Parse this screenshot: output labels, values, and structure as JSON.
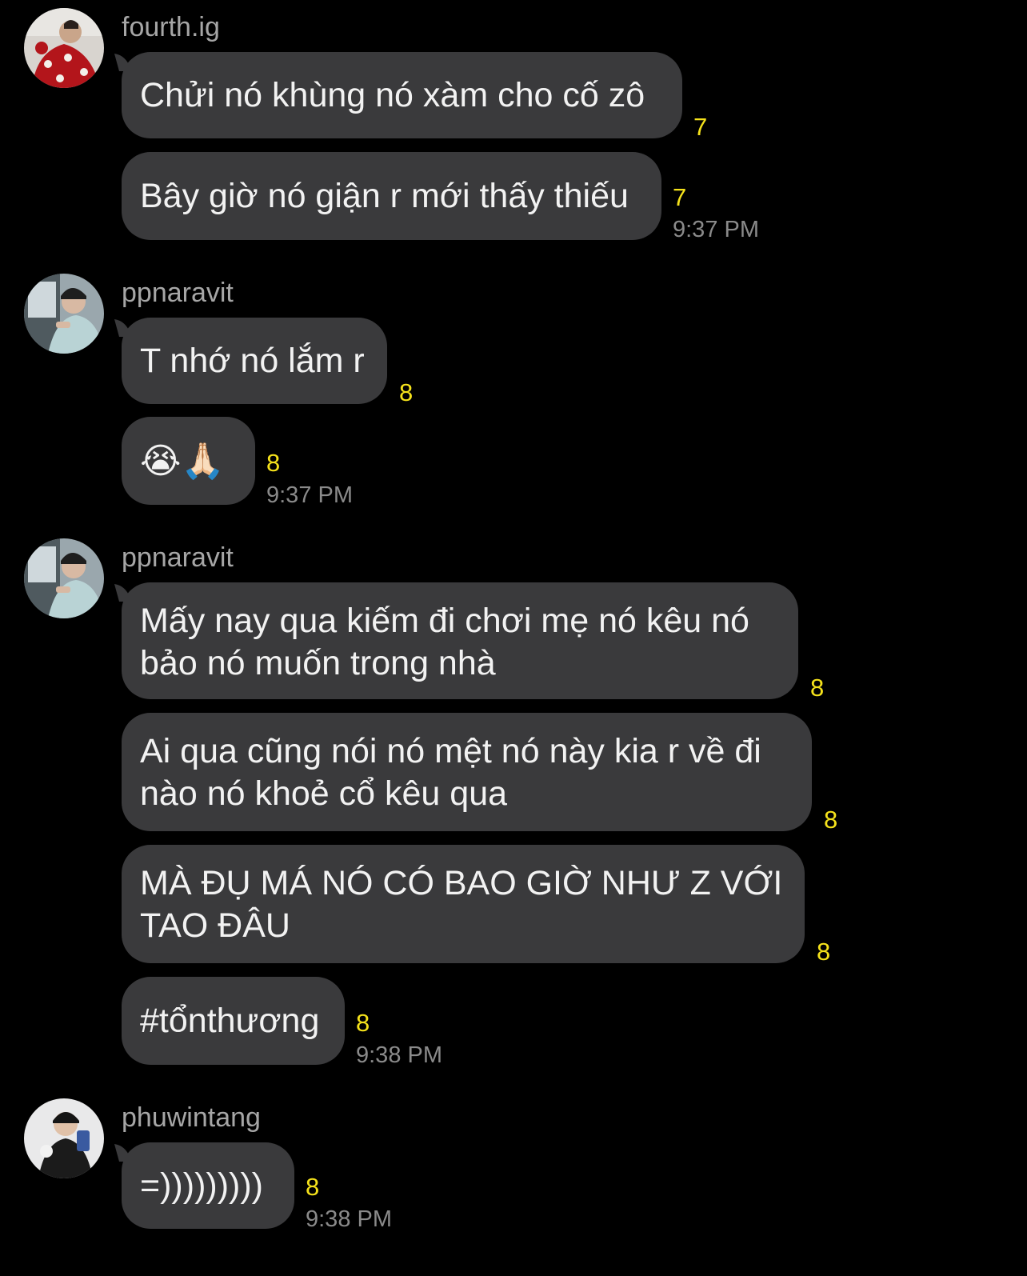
{
  "messages": [
    {
      "username": "fourth.ig",
      "bubbles": [
        {
          "text": "Chửi nó khùng nó xàm cho cố zô",
          "count": "7"
        },
        {
          "text": "Bây giờ nó giận r mới thấy thiếu",
          "count": "7"
        }
      ],
      "time": "9:37 PM"
    },
    {
      "username": "ppnaravit",
      "bubbles": [
        {
          "text": "T nhớ nó lắm r",
          "count": "8"
        },
        {
          "text": "😭🙏🏻",
          "count": "8"
        }
      ],
      "time": "9:37 PM"
    },
    {
      "username": "ppnaravit",
      "bubbles": [
        {
          "line1": "Mấy nay qua kiếm đi chơi mẹ nó kêu nó",
          "line2": "bảo nó muốn trong nhà",
          "count": "8"
        },
        {
          "line1": "Ai qua cũng nói nó mệt nó này kia r về đi",
          "line2": "nào nó khoẻ cổ kêu qua",
          "count": "8"
        },
        {
          "line1": "MÀ ĐỤ MÁ NÓ CÓ BAO GIỜ NHƯ Z VỚI",
          "line2": "TAO ĐÂU",
          "count": "8"
        },
        {
          "text": "#tổnthương",
          "count": "8"
        }
      ],
      "time": "9:38 PM"
    },
    {
      "username": "phuwintang",
      "bubbles": [
        {
          "text": "=)))))))))",
          "count": "8"
        }
      ],
      "time": "9:38 PM"
    }
  ]
}
